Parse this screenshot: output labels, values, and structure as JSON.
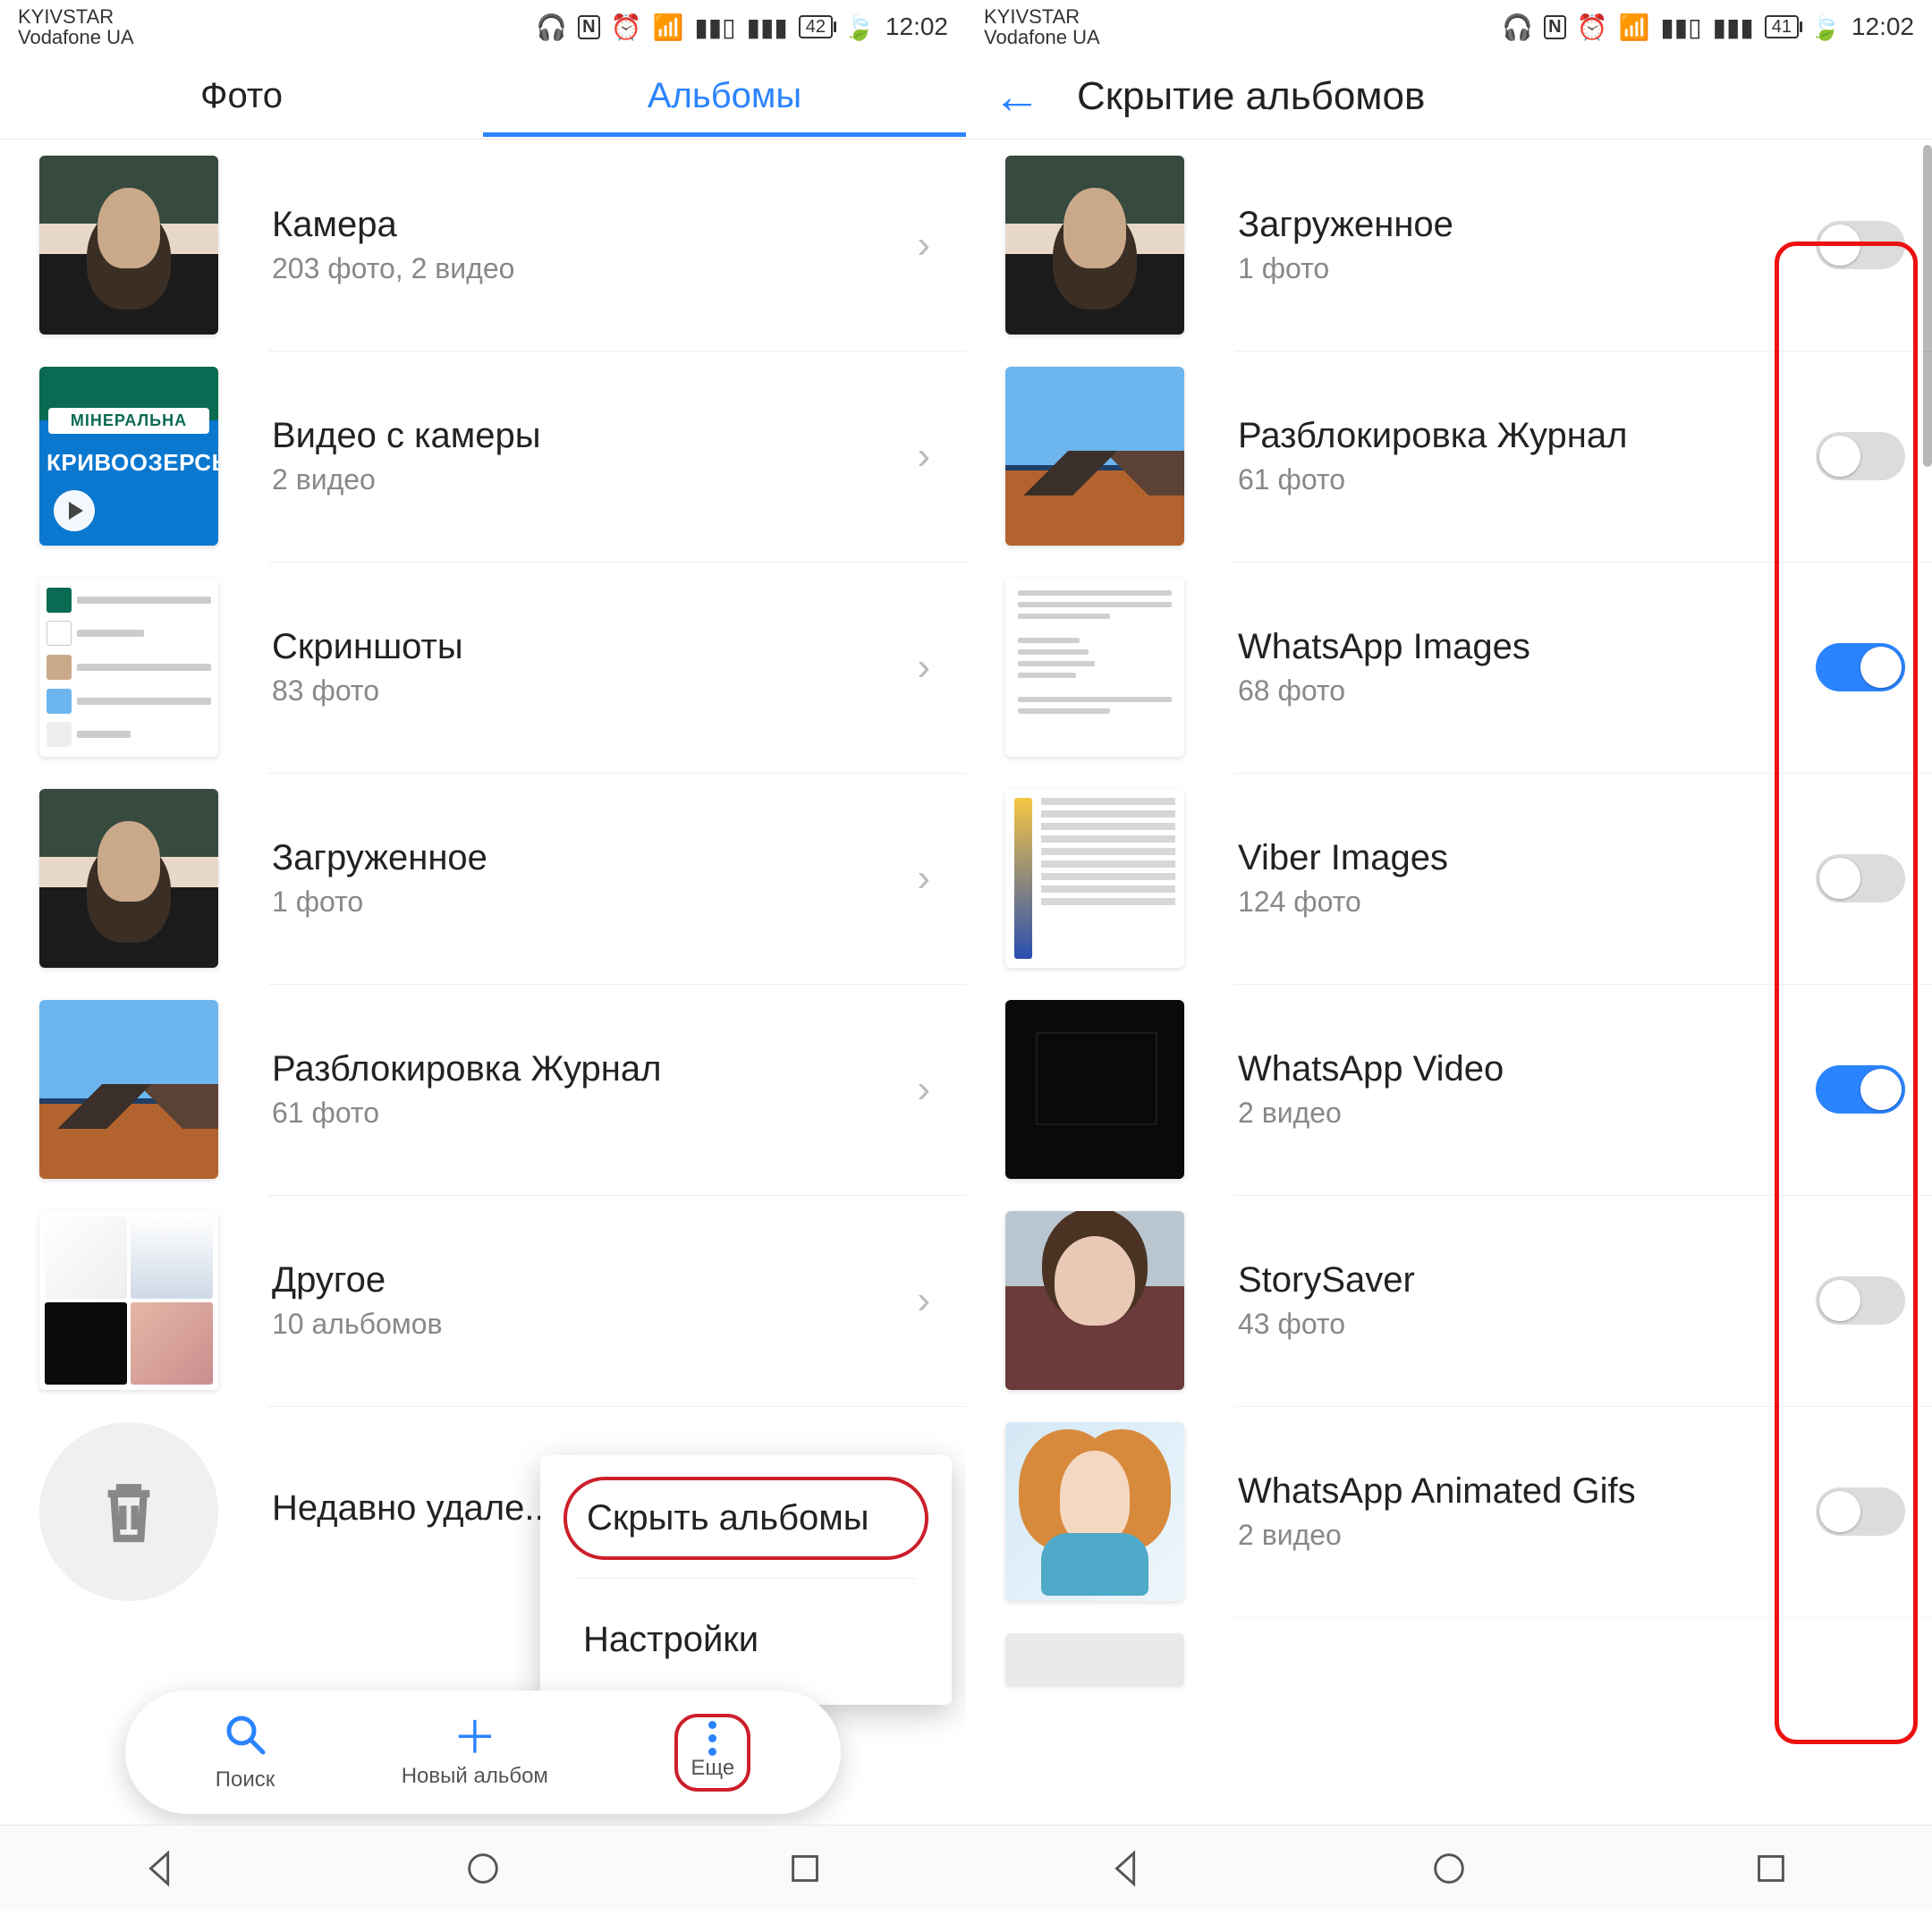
{
  "left": {
    "status": {
      "carrier1": "KYIVSTAR",
      "carrier2": "Vodafone UA",
      "battery": "42",
      "time": "12:02"
    },
    "tabs": {
      "photos": "Фото",
      "albums": "Альбомы"
    },
    "albums": [
      {
        "name": "Камера",
        "sub": "203 фото,  2 видео"
      },
      {
        "name": "Видео с камеры",
        "sub": "2 видео"
      },
      {
        "name": "Скриншоты",
        "sub": "83 фото"
      },
      {
        "name": "Загруженное",
        "sub": "1 фото"
      },
      {
        "name": "Разблокировка Журнал",
        "sub": "61 фото"
      },
      {
        "name": "Другое",
        "sub": "10 альбомов"
      },
      {
        "name": "Недавно удале...",
        "sub": ""
      }
    ],
    "popup": {
      "hide": "Скрыть альбомы",
      "settings": "Настройки"
    },
    "actionbar": {
      "search": "Поиск",
      "new": "Новый альбом",
      "more": "Еще"
    }
  },
  "right": {
    "status": {
      "carrier1": "KYIVSTAR",
      "carrier2": "Vodafone UA",
      "battery": "41",
      "time": "12:02"
    },
    "title": "Скрытие альбомов",
    "albums": [
      {
        "name": "Загруженное",
        "sub": "1 фото",
        "on": false
      },
      {
        "name": "Разблокировка Журнал",
        "sub": "61 фото",
        "on": false
      },
      {
        "name": "WhatsApp Images",
        "sub": "68 фото",
        "on": true
      },
      {
        "name": "Viber Images",
        "sub": "124 фото",
        "on": false
      },
      {
        "name": "WhatsApp Video",
        "sub": "2 видео",
        "on": true
      },
      {
        "name": "StorySaver",
        "sub": "43 фото",
        "on": false
      },
      {
        "name": "WhatsApp Animated Gifs",
        "sub": "2 видео",
        "on": false
      }
    ]
  }
}
